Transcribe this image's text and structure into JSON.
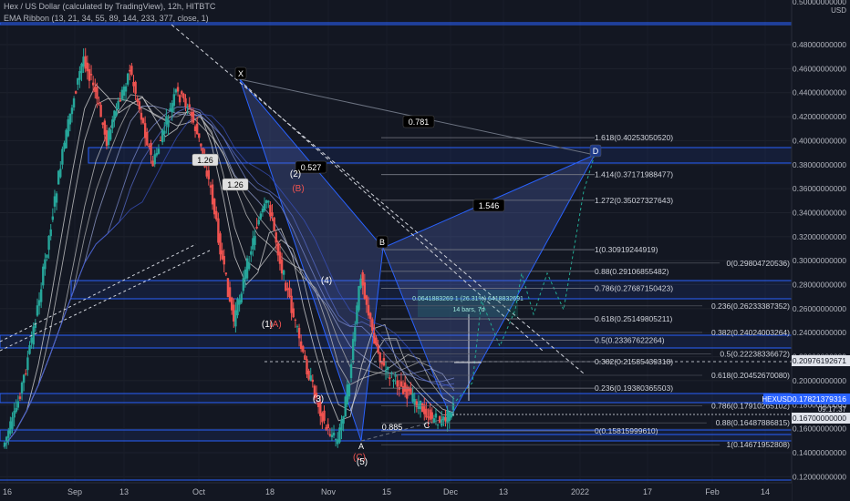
{
  "header": {
    "symbol_line": "Hex / US Dollar (calculated by TradingView), 12h, HITBTC",
    "indicator_line": "EMA Ribbon (13, 21, 34, 55, 89, 144, 233, 377, close, 1)"
  },
  "price_scale": {
    "currency": "USD",
    "current_symbol": "HEXUSD",
    "current_price": "0.17821379316",
    "countdown": "09:17:37",
    "marker_price": "0.20976192671",
    "low_marker": "0.16700000000"
  },
  "harmonic": {
    "points": [
      "X",
      "A",
      "B",
      "C",
      "D"
    ],
    "ratios": [
      "0.781",
      "0.885",
      "1.546"
    ]
  },
  "elliott": [
    "(2)",
    "(B)",
    "(4)",
    "(1)",
    "(A)",
    "(3)",
    "(C)",
    "(5)"
  ],
  "left_ratios": [
    "1.26",
    "1.26"
  ],
  "boxes": [
    "0.527",
    "0.0641883269 1 (26.31%) 6418832691",
    "14 bars, 7d"
  ],
  "chart_data": {
    "type": "line",
    "title": "Hex / US Dollar (calculated by TradingView), 12h, HITBTC",
    "x_ticks": [
      "16",
      "Sep",
      "13",
      "Oct",
      "18",
      "Nov",
      "15",
      "Dec",
      "13",
      "2022",
      "17",
      "Feb",
      "14"
    ],
    "ylim": [
      0.11,
      0.5
    ],
    "y_ticks": [
      0.12,
      0.14,
      0.16,
      0.18,
      0.2,
      0.22,
      0.24,
      0.26,
      0.28,
      0.3,
      0.32,
      0.34,
      0.36,
      0.38,
      0.4,
      0.42,
      0.44,
      0.46,
      0.48
    ],
    "y_tick_labels": [
      "0.12000000000",
      "0.14000000000",
      "0.16000000000",
      "0.18000000000",
      "0.20000000000",
      "0.22000000000",
      "0.24000000000",
      "0.26000000000",
      "0.28000000000",
      "0.30000000000",
      "0.32000000000",
      "0.34000000000",
      "0.36000000000",
      "0.38000000000",
      "0.40000000000",
      "0.42000000000",
      "0.44000000000",
      "0.46000000000",
      "0.48000000000"
    ],
    "y_top_label": "0.50000000000",
    "series": [
      {
        "values": [
          0.145,
          0.17,
          0.21,
          0.26,
          0.32,
          0.38,
          0.43,
          0.47,
          0.44,
          0.4,
          0.43,
          0.46,
          0.42,
          0.38,
          0.41,
          0.44,
          0.43,
          0.4,
          0.36,
          0.3,
          0.25,
          0.29,
          0.33,
          0.35,
          0.3,
          0.26,
          0.22,
          0.19,
          0.16,
          0.15,
          0.2,
          0.29,
          0.24,
          0.21,
          0.2,
          0.19,
          0.18,
          0.17,
          0.165,
          0.178
        ]
      }
    ],
    "fib_levels_right": [
      {
        "label": "1.618(0.40253050520)",
        "value": 0.4025
      },
      {
        "label": "1.414(0.37171988477)",
        "value": 0.3717
      },
      {
        "label": "1.272(0.35027327643)",
        "value": 0.3503
      },
      {
        "label": "1(0.30919244919)",
        "value": 0.3092
      },
      {
        "label": "0.88(0.29106855482)",
        "value": 0.2911
      },
      {
        "label": "0.786(0.27687150423)",
        "value": 0.2769
      },
      {
        "label": "0.618(0.25149805211)",
        "value": 0.2515
      },
      {
        "label": "0.5(0.23367622264)",
        "value": 0.2337
      },
      {
        "label": "0.382(0.21585439318)",
        "value": 0.2159
      },
      {
        "label": "0.236(0.19380365503)",
        "value": 0.1938
      },
      {
        "label": "0(0.15815999610)",
        "value": 0.1582
      }
    ],
    "fib_levels_far": [
      {
        "label": "0(0.29804720536)",
        "value": 0.298
      },
      {
        "label": "0.236(0.26233387352)",
        "value": 0.2623
      },
      {
        "label": "0.382(0.24024003264)",
        "value": 0.2402
      },
      {
        "label": "0.5(0.22238336672)",
        "value": 0.2224
      },
      {
        "label": "0.618(0.20452670080)",
        "value": 0.2045
      },
      {
        "label": "0.786(0.17910265102)",
        "value": 0.1791
      },
      {
        "label": "0.88(0.16487886815)",
        "value": 0.1649
      },
      {
        "label": "1(0.14671952808)",
        "value": 0.1467
      }
    ]
  }
}
